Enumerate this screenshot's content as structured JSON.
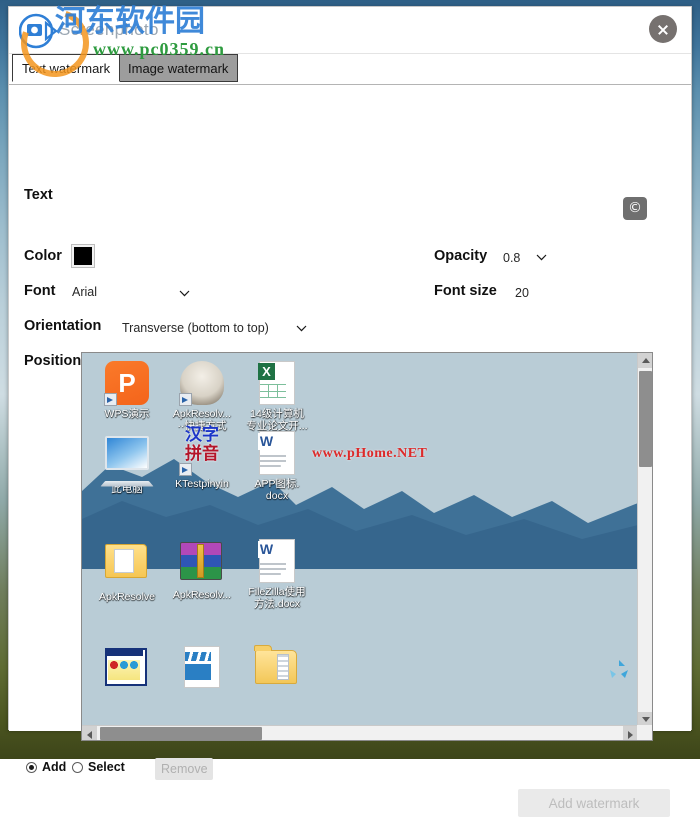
{
  "window": {
    "app_title": "Screenphoto",
    "close_label": "close-icon"
  },
  "watermark_overlay": {
    "cn_text": "河东软件园",
    "url_text": "www.pc0359.cn"
  },
  "tabs": [
    {
      "label": "Text watermark",
      "active": true
    },
    {
      "label": "Image watermark",
      "active": false
    }
  ],
  "form": {
    "text": {
      "label": "Text",
      "value": "",
      "placeholder": ""
    },
    "copyright_button": {
      "glyph": "©",
      "name": "copyright-icon"
    },
    "color": {
      "label": "Color",
      "value": "#000000"
    },
    "font": {
      "label": "Font",
      "value": "Arial"
    },
    "orientation": {
      "label": "Orientation",
      "value": "Transverse (bottom to top)"
    },
    "opacity": {
      "label": "Opacity",
      "value": "0.8"
    },
    "font_size": {
      "label": "Font size",
      "value": "20"
    },
    "position": {
      "label": "Position"
    }
  },
  "preview": {
    "watermark_text": "www.pHome.NET",
    "icons": [
      {
        "name": "WPS演示",
        "line2": ""
      },
      {
        "name": "ApkResolv...",
        "line2": "··快捷方式"
      },
      {
        "name": "14级计算机",
        "line2": "专业论文开..."
      },
      {
        "name": "此电脑",
        "line2": ""
      },
      {
        "name": "KTestpinyin",
        "line2": ""
      },
      {
        "name": "APP图标.",
        "line2": "docx"
      },
      {
        "name": "ApkResolve",
        "line2": ""
      },
      {
        "name": "ApkResolv...",
        "line2": ""
      },
      {
        "name": "FileZilla使用",
        "line2": "方法.docx"
      }
    ]
  },
  "bottom": {
    "radio_add": "Add",
    "radio_select": "Select",
    "remove_button": "Remove",
    "add_watermark_button": "Add watermark"
  }
}
